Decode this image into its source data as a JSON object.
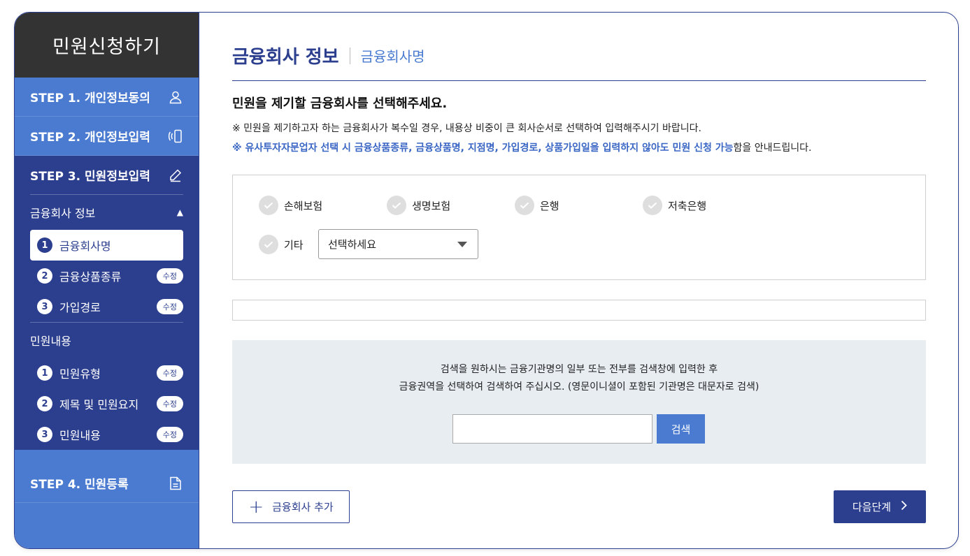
{
  "sidebar": {
    "title": "민원신청하기",
    "step1": "STEP 1. 개인정보동의",
    "step2": "STEP 2. 개인정보입력",
    "step3": "STEP 3. 민원정보입력",
    "step4": "STEP 4. 민원등록",
    "section1": "금융회사 정보",
    "section1_items": [
      {
        "num": "1",
        "label": "금융회사명",
        "badge": ""
      },
      {
        "num": "2",
        "label": "금융상품종류",
        "badge": "수정"
      },
      {
        "num": "3",
        "label": "가입경로",
        "badge": "수정"
      }
    ],
    "section2": "민원내용",
    "section2_items": [
      {
        "num": "1",
        "label": "민원유형",
        "badge": "수정"
      },
      {
        "num": "2",
        "label": "제목 및 민원요지",
        "badge": "수정"
      },
      {
        "num": "3",
        "label": "민원내용",
        "badge": "수정"
      }
    ]
  },
  "main": {
    "title": "금융회사 정보",
    "subtitle": "금융회사명",
    "question": "민원을 제기할 금융회사를 선택해주세요.",
    "note1": "※ 민원을 제기하고자 하는 금융회사가 복수일 경우, 내용상 비중이 큰 회사순서로 선택하여 입력해주시기 바랍니다.",
    "note2_prefix": "※ ",
    "note2_highlight": "유사투자자문업자 선택 시 금융상품종류, 금융상품명, 지점명, 가입경로, 상품가입일을 입력하지 않아도 민원 신청 가능",
    "note2_suffix": "함을 안내드립니다.",
    "options": [
      "손해보험",
      "생명보험",
      "은행",
      "저축은행"
    ],
    "other_label": "기타",
    "select_value": "선택하세요",
    "search_line1": "검색을 원하시는 금융기관명의 일부 또는 전부를 검색창에 입력한 후",
    "search_line2": "금융권역을 선택하여 검색하여 주십시오. (영문이니셜이 포함된 기관명은 대문자로 검색)",
    "search_value": "",
    "search_button": "검색",
    "add_button": "금융회사 추가",
    "next_button": "다음단계"
  }
}
